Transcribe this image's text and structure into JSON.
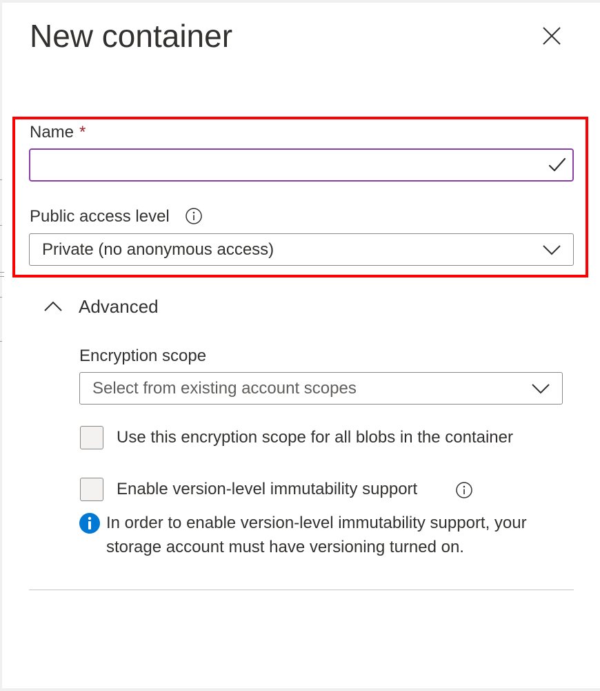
{
  "panel": {
    "title": "New container",
    "close_icon": "close-icon"
  },
  "name_field": {
    "label": "Name",
    "required_marker": "*",
    "value": "",
    "placeholder": "",
    "valid_icon": "checkmark-icon"
  },
  "access_level": {
    "label": "Public access level",
    "info_icon": "info-icon",
    "selected": "Private (no anonymous access)",
    "dropdown_icon": "chevron-down-icon"
  },
  "advanced": {
    "label": "Advanced",
    "expanded": true,
    "toggle_icon": "chevron-up-icon",
    "encryption_scope": {
      "label": "Encryption scope",
      "placeholder": "Select from existing account scopes",
      "dropdown_icon": "chevron-down-icon"
    },
    "use_scope_checkbox": {
      "label": "Use this encryption scope for all blobs in the container",
      "checked": false
    },
    "immutability_checkbox": {
      "label": "Enable version-level immutability support",
      "checked": false,
      "info_icon": "info-icon"
    },
    "info_message": {
      "icon": "info-filled-icon",
      "text": "In order to enable version-level immutability support, your storage account must have versioning turned on."
    }
  },
  "colors": {
    "highlight": "#ff0000",
    "input_focus_border": "#8a3fa7",
    "required": "#a4262c",
    "info_blue": "#0078d4"
  }
}
